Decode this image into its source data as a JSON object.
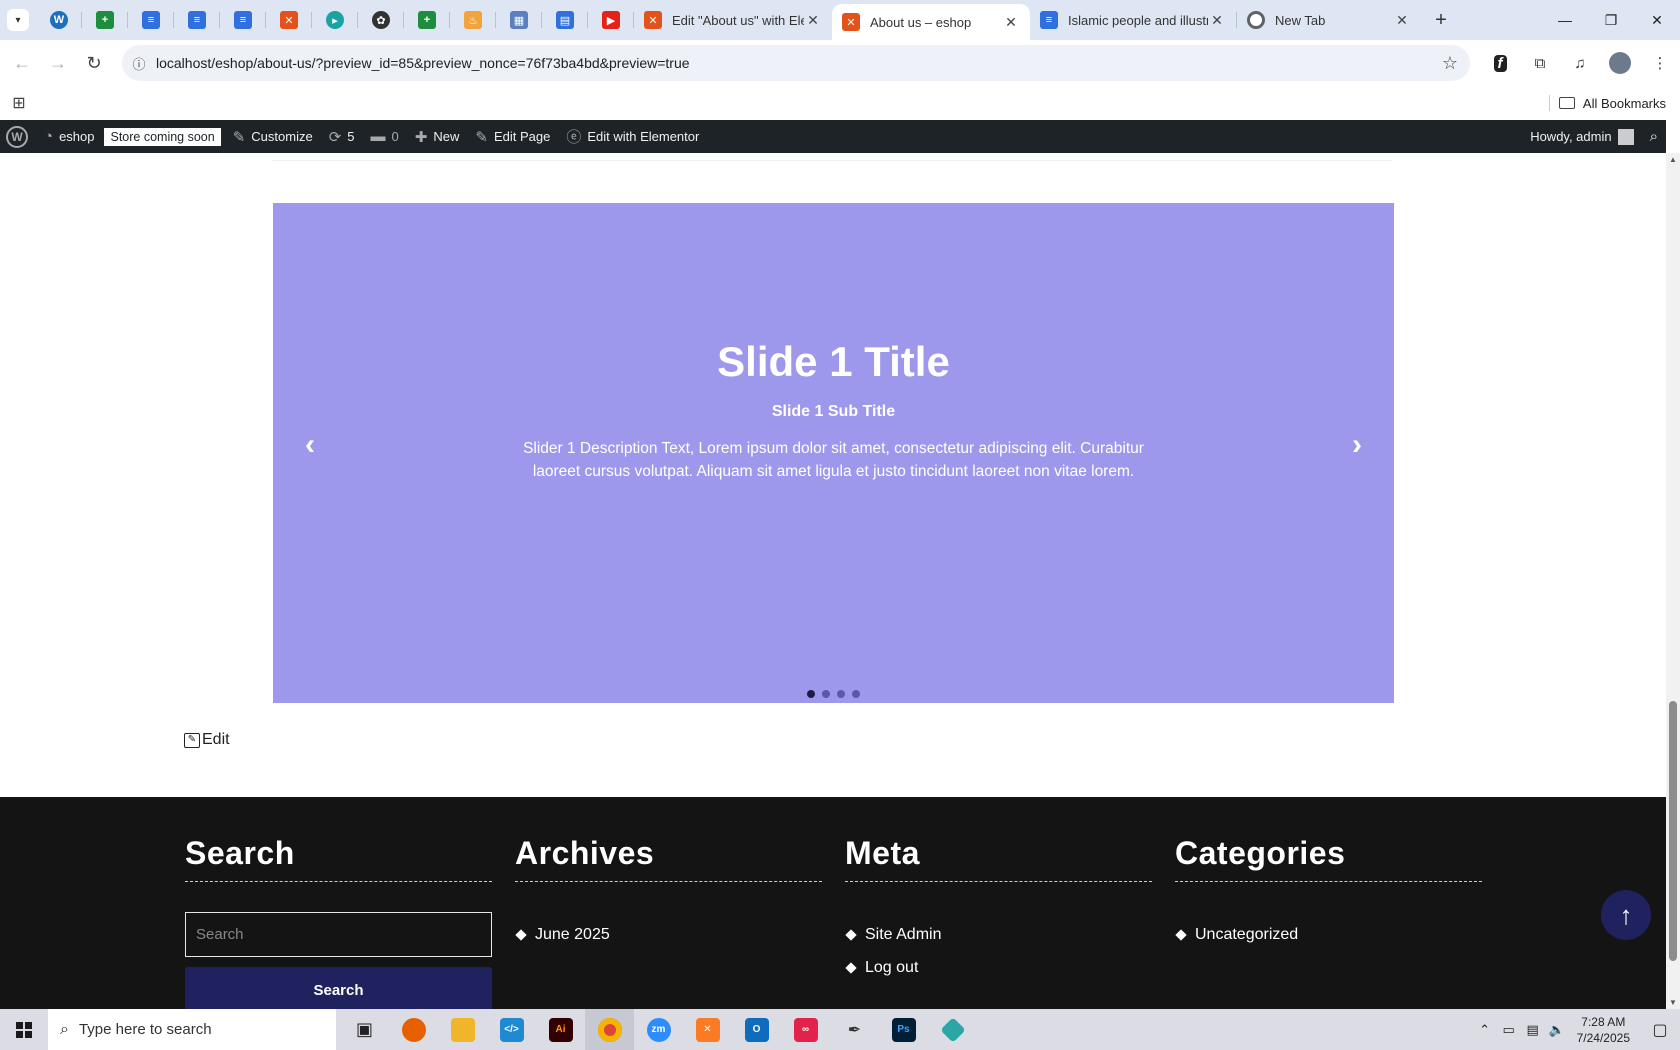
{
  "browser": {
    "tabs": [
      {
        "title": "Edit \"About us\" with Elem",
        "icon": "elementor-icon",
        "color": "#e2521a",
        "active": false
      },
      {
        "title": "About us – eshop",
        "icon": "xampp-icon",
        "color": "#e2521a",
        "active": true
      },
      {
        "title": "Islamic people and illustra",
        "icon": "docs-icon",
        "color": "#2f6fde",
        "active": false
      },
      {
        "title": "New Tab",
        "icon": "chrome-icon",
        "color": "#5f6368",
        "active": false
      }
    ],
    "url": "localhost/eshop/about-us/?preview_id=85&preview_nonce=76f73ba4bd&preview=true",
    "bookmarks_label": "All Bookmarks"
  },
  "adminbar": {
    "site": "eshop",
    "store_badge": "Store coming soon",
    "customize": "Customize",
    "updates": "5",
    "comments": "0",
    "new": "New",
    "edit_page": "Edit Page",
    "elementor": "Edit with Elementor",
    "howdy": "Howdy, admin"
  },
  "slider": {
    "title": "Slide 1 Title",
    "subtitle": "Slide 1 Sub Title",
    "description": "Slider 1 Description Text, Lorem ipsum dolor sit amet, consectetur adipiscing elit. Curabitur laoreet cursus volutpat. Aliquam sit amet ligula et justo tincidunt laoreet non vitae lorem.",
    "background": "#9e98ec",
    "slides_count": 4,
    "active_slide": 1
  },
  "edit_link": "Edit",
  "footer": {
    "search": {
      "heading": "Search",
      "placeholder": "Search",
      "button": "Search"
    },
    "archives": {
      "heading": "Archives",
      "items": [
        "June 2025"
      ]
    },
    "meta": {
      "heading": "Meta",
      "items": [
        "Site Admin",
        "Log out"
      ]
    },
    "categories": {
      "heading": "Categories",
      "items": [
        "Uncategorized"
      ]
    }
  },
  "taskbar": {
    "search_placeholder": "Type here to search",
    "time": "7:28 AM",
    "date": "7/24/2025"
  }
}
